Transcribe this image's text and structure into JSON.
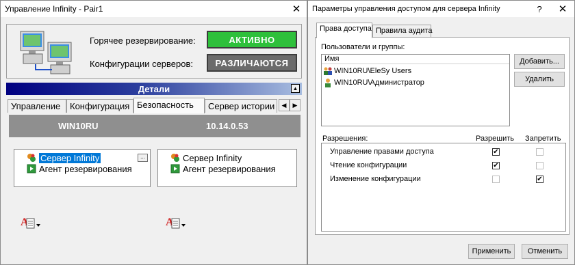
{
  "window1": {
    "title": "Управление Infinity - Pair1",
    "hot_reserve_label": "Горячее резервирование:",
    "hot_reserve_status": "АКТИВНО",
    "config_label": "Конфигурации серверов:",
    "config_status": "РАЗЛИЧАЮТСЯ",
    "details_title": "Детали",
    "tabs": [
      "Управление",
      "Конфигурация",
      "Безопасность",
      "Сервер истории"
    ],
    "active_tab": "Безопасность",
    "server_name": "WIN10RU",
    "server_ip": "10.14.0.53",
    "left_tree": [
      "Сервер Infinity",
      "Агент резервирования"
    ],
    "right_tree": [
      "Сервер Infinity",
      "Агент резервирования"
    ],
    "selected_item": "Сервер Infinity",
    "more_button": "...",
    "colors": {
      "active_green": "#2ec03b",
      "differ_gray": "#6b6b6b",
      "details_bar": "#000080",
      "header_gray": "#8f8f8f",
      "selection": "#0078d7"
    }
  },
  "window2": {
    "title": "Параметры управления доступом для сервера Infinity",
    "help": "?",
    "tabs": [
      "Права доступа",
      "Правила аудита"
    ],
    "active_tab": "Права доступа",
    "users_groups_label": "Пользователи и группы:",
    "name_header": "Имя",
    "users": [
      {
        "name": "WIN10RU\\EleSy Users",
        "icon": "users-group-icon"
      },
      {
        "name": "WIN10RU\\Администратор",
        "icon": "user-icon"
      }
    ],
    "add_button": "Добавить...",
    "delete_button": "Удалить",
    "permissions_label": "Разрешения:",
    "allow_header": "Разрешить",
    "deny_header": "Запретить",
    "permissions": [
      {
        "name": "Управление правами доступа",
        "allow": true,
        "deny": false
      },
      {
        "name": "Чтение конфигурации",
        "allow": true,
        "deny": false
      },
      {
        "name": "Изменение конфигурации",
        "allow": false,
        "deny": true
      }
    ],
    "apply_button": "Применить",
    "cancel_button": "Отменить"
  }
}
